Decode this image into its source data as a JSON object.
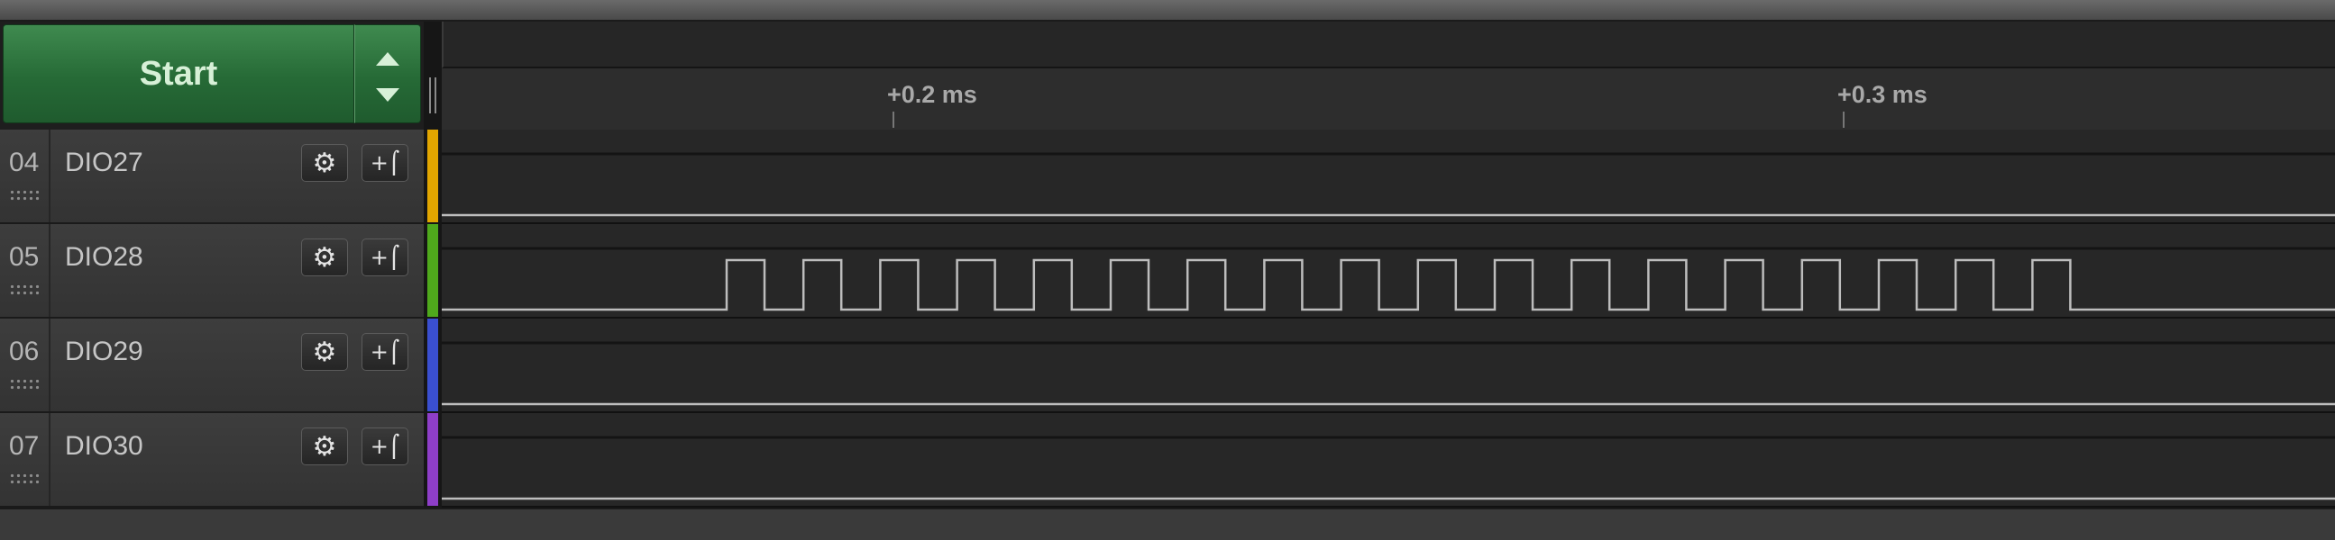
{
  "controls": {
    "start_label": "Start"
  },
  "ruler": {
    "ticks": [
      {
        "label": "+0.2 ms"
      },
      {
        "label": "+0.3 ms"
      }
    ]
  },
  "channels": [
    {
      "number": "04",
      "name": "DIO27",
      "color": "#e2a600",
      "signal": "low"
    },
    {
      "number": "05",
      "name": "DIO28",
      "color": "#4fa91c",
      "signal": "pulse train",
      "pulse_count": 18
    },
    {
      "number": "06",
      "name": "DIO29",
      "color": "#3a4fd0",
      "signal": "low"
    },
    {
      "number": "07",
      "name": "DIO30",
      "color": "#8e3ec8",
      "signal": "low"
    }
  ],
  "icons": [
    "gear-icon",
    "trigger-edge-icon",
    "chevron-up-icon",
    "chevron-down-icon",
    "drag-handle-icon"
  ]
}
